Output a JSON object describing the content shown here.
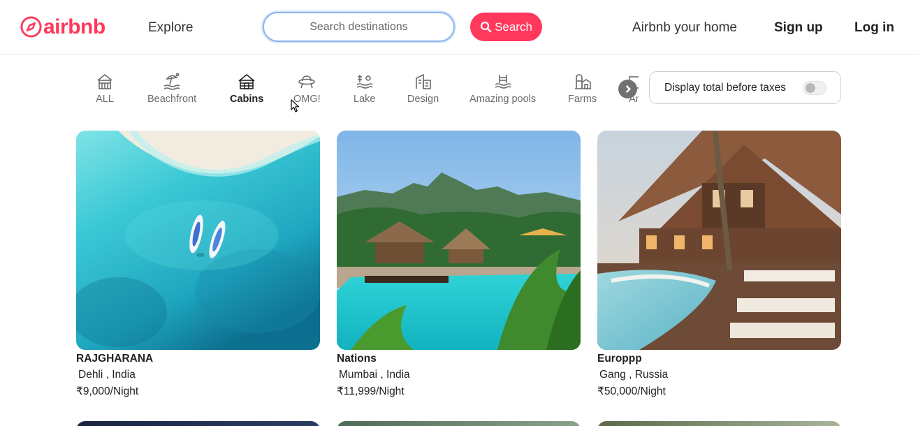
{
  "header": {
    "logo_text": "airbnb",
    "explore_label": "Explore",
    "search_placeholder": "Search destinations",
    "search_button_label": "Search",
    "host_link": "Airbnb your home",
    "signup_link": "Sign up",
    "login_link": "Log in"
  },
  "categories": [
    {
      "label": "ALL",
      "icon": "house-icon",
      "active": false
    },
    {
      "label": "Beachfront",
      "icon": "beach-umbrella-icon",
      "active": false
    },
    {
      "label": "Cabins",
      "icon": "cabin-icon",
      "active": true
    },
    {
      "label": "OMG!",
      "icon": "ufo-icon",
      "active": false
    },
    {
      "label": "Lake",
      "icon": "lake-icon",
      "active": false
    },
    {
      "label": "Design",
      "icon": "design-building-icon",
      "active": false
    },
    {
      "label": "Amazing pools",
      "icon": "pool-icon",
      "active": false
    },
    {
      "label": "Farms",
      "icon": "farm-icon",
      "active": false
    },
    {
      "label": "An",
      "icon": "partial-category-icon",
      "active": false
    }
  ],
  "next_icon": "chevron-right-icon",
  "tax_toggle": {
    "label": "Display total before taxes",
    "on": false
  },
  "listings": [
    {
      "title": "RAJGHARANA",
      "location": "Dehli , India",
      "price": "₹9,000/Night"
    },
    {
      "title": "Nations",
      "location": "Mumbai , India",
      "price": "₹11,999/Night"
    },
    {
      "title": "Europpp",
      "location": "Gang , Russia",
      "price": "₹50,000/Night"
    }
  ],
  "colors": {
    "brand": "#ff385c",
    "text": "#222222",
    "muted": "#6a6a6a",
    "border": "#e5e5e5"
  }
}
